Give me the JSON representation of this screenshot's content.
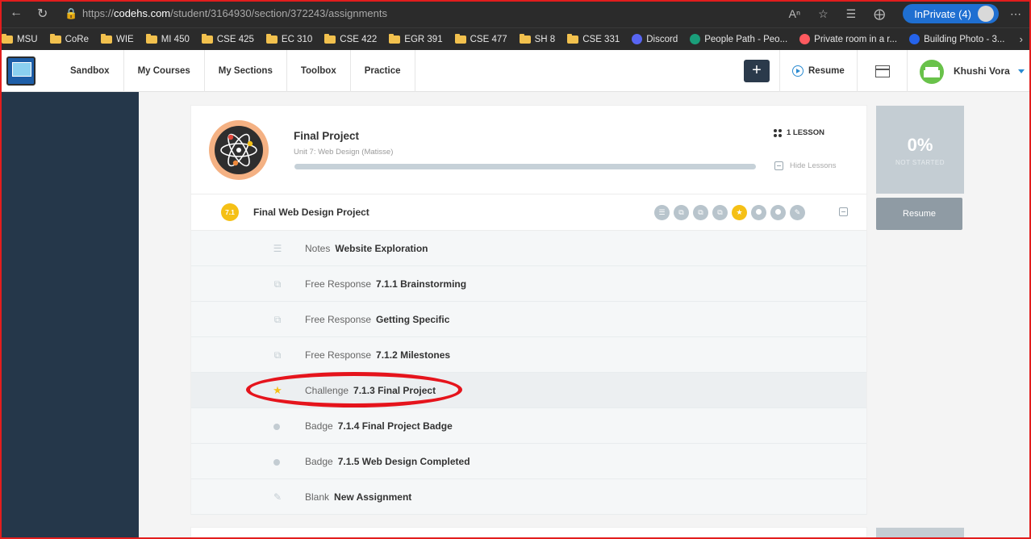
{
  "browser": {
    "url_prefix": "https://",
    "url_domain": "codehs.com",
    "url_path": "/student/3164930/section/372243/assignments",
    "inprivate_label": "InPrivate (4)",
    "bookmarks": [
      {
        "label": "MSU",
        "icon": "folder-icon"
      },
      {
        "label": "CoRe",
        "icon": "folder-icon"
      },
      {
        "label": "WIE",
        "icon": "folder-icon"
      },
      {
        "label": "MI 450",
        "icon": "folder-icon"
      },
      {
        "label": "CSE 425",
        "icon": "folder-icon"
      },
      {
        "label": "EC 310",
        "icon": "folder-icon"
      },
      {
        "label": "CSE 422",
        "icon": "folder-icon"
      },
      {
        "label": "EGR 391",
        "icon": "folder-icon"
      },
      {
        "label": "CSE 477",
        "icon": "folder-icon"
      },
      {
        "label": "SH 8",
        "icon": "folder-icon"
      },
      {
        "label": "CSE 331",
        "icon": "folder-icon"
      },
      {
        "label": "Discord",
        "icon": "discord-icon"
      },
      {
        "label": "People Path - Peo...",
        "icon": "peoplepath-icon"
      },
      {
        "label": "Private room in a r...",
        "icon": "airbnb-icon"
      },
      {
        "label": "Building Photo - 3...",
        "icon": "fr-icon"
      }
    ]
  },
  "nav": {
    "links": [
      "Sandbox",
      "My Courses",
      "My Sections",
      "Toolbox",
      "Practice"
    ],
    "plus": "+",
    "resume": "Resume",
    "user": "Khushi Vora"
  },
  "project": {
    "title": "Final Project",
    "subtitle": "Unit 7: Web Design (Matisse)",
    "lessons": "1 LESSON",
    "hide_lessons": "Hide Lessons",
    "progress": 0,
    "percent": "0%",
    "status": "NOT STARTED",
    "resume": "Resume",
    "unit": {
      "number": "7.1",
      "title": "Final Web Design Project"
    },
    "items": [
      {
        "type": "Notes",
        "name": "Website Exploration",
        "icon": "list-icon"
      },
      {
        "type": "Free Response",
        "name": "7.1.1 Brainstorming",
        "icon": "copy-icon"
      },
      {
        "type": "Free Response",
        "name": "Getting Specific",
        "icon": "copy-icon"
      },
      {
        "type": "Free Response",
        "name": "7.1.2 Milestones",
        "icon": "copy-icon"
      },
      {
        "type": "Challenge",
        "name": "7.1.3 Final Project",
        "icon": "star-icon"
      },
      {
        "type": "Badge",
        "name": "7.1.4 Final Project Badge",
        "icon": "dot-icon"
      },
      {
        "type": "Badge",
        "name": "7.1.5 Web Design Completed",
        "icon": "dot-icon"
      },
      {
        "type": "Blank",
        "name": "New Assignment",
        "icon": "pencil-icon"
      }
    ]
  },
  "colors": {
    "sidebar": "#25374a",
    "accent": "#f5c016",
    "annotation": "#e5141c"
  }
}
